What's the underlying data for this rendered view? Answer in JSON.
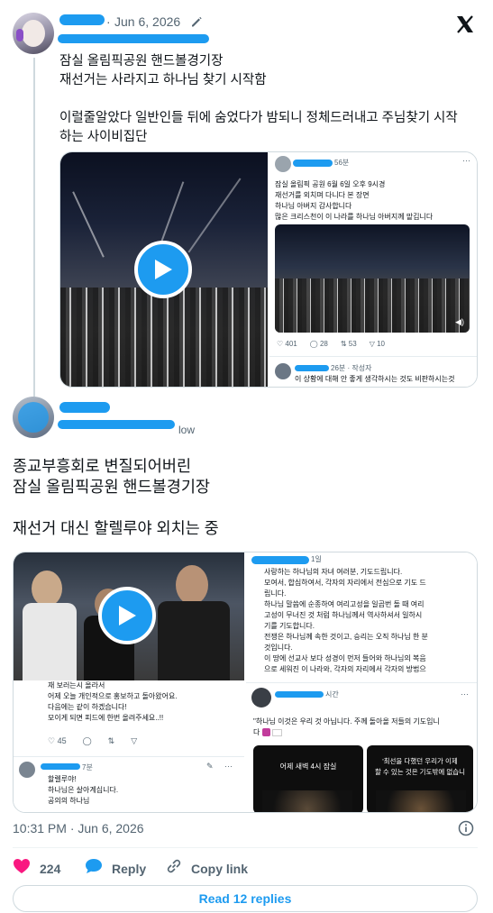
{
  "tweet": {
    "date": "Jun 6, 2026",
    "separator": "·",
    "body_lines": [
      "잠실 올림픽공원 핸드볼경기장",
      "재선거는 사라지고 하나님 찾기 시작함",
      "",
      "이럴줄알았다 일반인들 뒤에 숨었다가 밤되니 정체드러내고 주님찾기 시작",
      "하는 사이비집단"
    ],
    "footer_time": "10:31 PM · Jun 6, 2026",
    "likes": "224",
    "reply_label": "Reply",
    "copy_link_label": "Copy link",
    "read_replies_label": "Read 12 replies"
  },
  "embedded_card": {
    "time_suffix": "56분",
    "lines": [
      "잠실 올림픽 공원 6월 6일 오후 9시경",
      "재선거를 외치며 다니다 본 장면",
      "하나님 아버지 감사합니다",
      "많은 크리스천이 이 나라를 하나님 아버지께 맡깁니다"
    ],
    "stats": {
      "replies": "401",
      "retweets": "28",
      "likes": "53",
      "views": "10"
    },
    "reply_time": "26분 · 작성자",
    "reply_text": "이 상황에 대해 안 좋게 생각하시는 것도 비판하시는것"
  },
  "quoted": {
    "handle_suffix": "low",
    "body_lines": [
      "종교부흥회로 변질되어버린",
      "잠실 올림픽공원 핸드볼경기장",
      "",
      "재선거 대신 할렐루야 외치는 중"
    ]
  },
  "quoted_media": {
    "left_lines": [
      "재 보러는시 올라서",
      "어제 오늘 개인적으로 홍보하고 돌아왔어요.",
      "다음에는 같이 하겠습니다!",
      "모이게 되면 피드에 한번 올려주세요..!!"
    ],
    "left_stats": {
      "replies": "45"
    },
    "left_reply_time": "7분",
    "left_reply_lines": [
      "할렐루야!",
      "하나님은 살아계십니다.",
      "공의의 하나님"
    ],
    "right_time": "1일",
    "right_lines": [
      "사랑하는 하나님의 자녀 여러분, 기도드립니다.",
      "모여서, 합심하여서, 각자의 자리에서 전심으로 기도 드",
      "립니다.",
      "하나님 말씀에 순종하여 여리고성을 일곱번 돌 때 여리",
      "고성이 무너진 것 처럼 하나님께서 역사하셔서 일하시",
      "기를 기도합니다.",
      "전쟁은 하나님께 속한 것이고, 승리는 오직 하나님 한 분",
      "것입니다.",
      "이 땅에 선교사 보다 성경이 먼저 들어와 하나님의 복음",
      "으로 세워진 이 나라와, 각자의 자리에서 각자의 방법으"
    ],
    "right_reply_time": "시간",
    "right_reply_line1": "\"하나님 이것은 우리 것 아닙니다. 주께 돌아올 저들의 기도입니",
    "right_reply_line2": "다",
    "thumb_left_caption": "어제 새벽 4시 잠실",
    "thumb_right_caption_1": "'최선을 다했던 우리가 이제",
    "thumb_right_caption_2": "할 수 있는 것은 기도밖에 없습니"
  },
  "colors": {
    "accent": "#1d9bf0",
    "like": "#f91880",
    "border": "#cfd9de",
    "muted": "#536471"
  }
}
